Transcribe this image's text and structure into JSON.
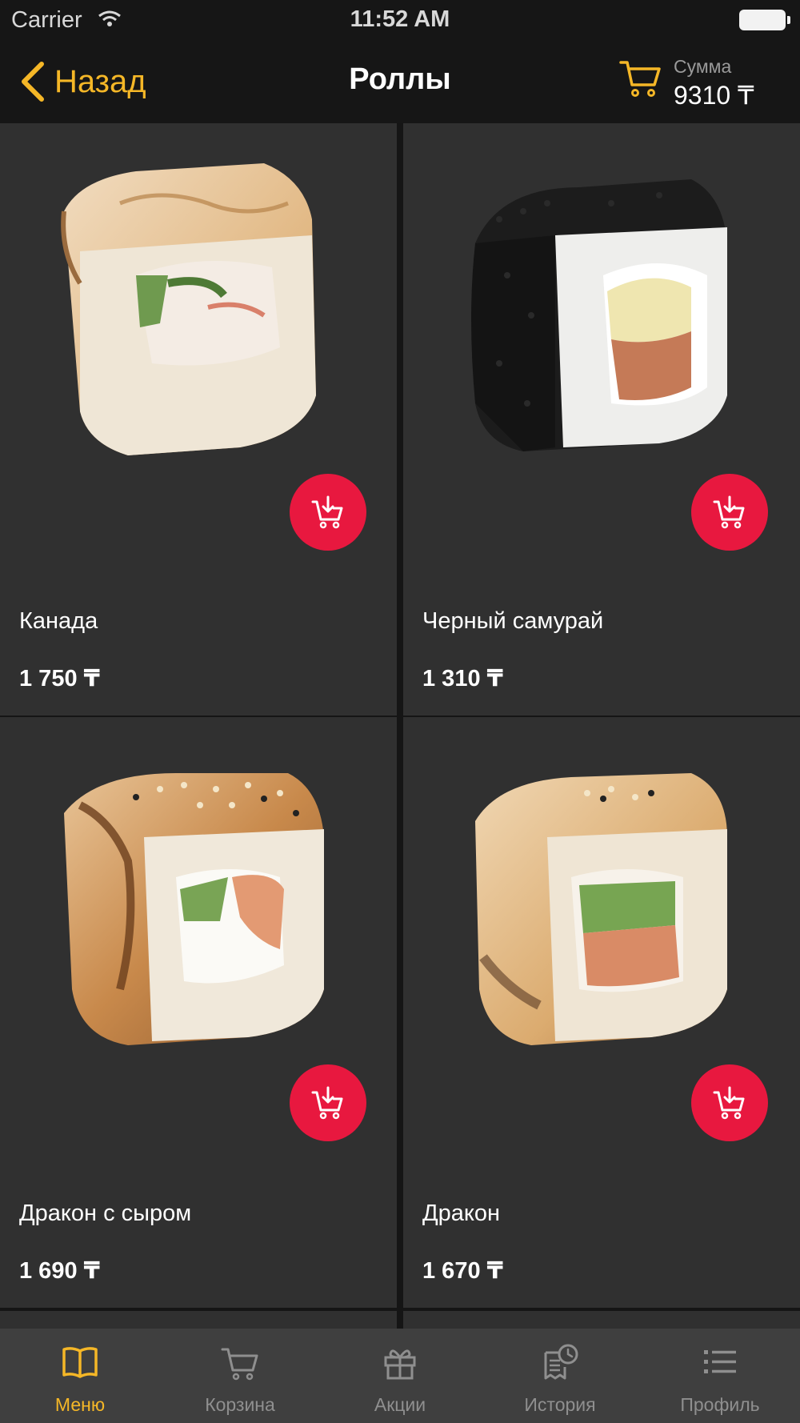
{
  "status_bar": {
    "carrier": "Carrier",
    "time": "11:52 AM"
  },
  "nav": {
    "back_label": "Назад",
    "title": "Роллы",
    "sum_label": "Сумма",
    "sum_value": "9310 ₸"
  },
  "products": [
    {
      "name": "Канада",
      "price": "1 750 ₸",
      "image": "roll-canada"
    },
    {
      "name": "Черный самурай",
      "price": "1 310 ₸",
      "image": "roll-black-samurai"
    },
    {
      "name": "Дракон с сыром",
      "price": "1 690 ₸",
      "image": "roll-dragon-cheese"
    },
    {
      "name": "Дракон",
      "price": "1 670 ₸",
      "image": "roll-dragon"
    }
  ],
  "tabs": [
    {
      "label": "Меню",
      "icon": "book-icon",
      "active": true
    },
    {
      "label": "Корзина",
      "icon": "cart-icon",
      "active": false
    },
    {
      "label": "Акции",
      "icon": "gift-icon",
      "active": false
    },
    {
      "label": "История",
      "icon": "history-icon",
      "active": false
    },
    {
      "label": "Профиль",
      "icon": "list-icon",
      "active": false
    }
  ],
  "colors": {
    "accent": "#f5b727",
    "add_button": "#e8183f",
    "card_background": "#303030",
    "tab_bar": "#3f3f3f"
  }
}
